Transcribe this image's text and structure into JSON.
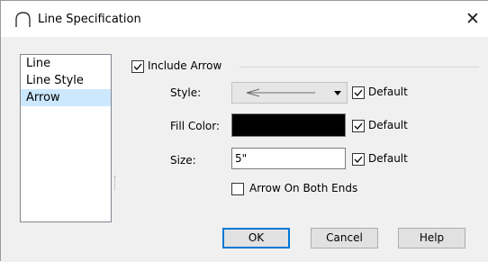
{
  "window": {
    "title": "Line Specification",
    "close_glyph": "✕",
    "icon": "arc-icon"
  },
  "nav": {
    "items": [
      {
        "label": "Line",
        "selected": false
      },
      {
        "label": "Line Style",
        "selected": false
      },
      {
        "label": "Arrow",
        "selected": true
      }
    ]
  },
  "include_arrow": {
    "label": "Include Arrow",
    "checked": true
  },
  "style": {
    "label": "Style:",
    "value_icon": "arrow-left-icon",
    "default_label": "Default",
    "default_checked": true
  },
  "fill_color": {
    "label": "Fill Color:",
    "color": "#000000",
    "default_label": "Default",
    "default_checked": true
  },
  "size": {
    "label": "Size:",
    "value": "5\"",
    "default_label": "Default",
    "default_checked": true
  },
  "both_ends": {
    "label": "Arrow On Both Ends",
    "checked": false
  },
  "buttons": {
    "ok": "OK",
    "cancel": "Cancel",
    "help": "Help"
  }
}
